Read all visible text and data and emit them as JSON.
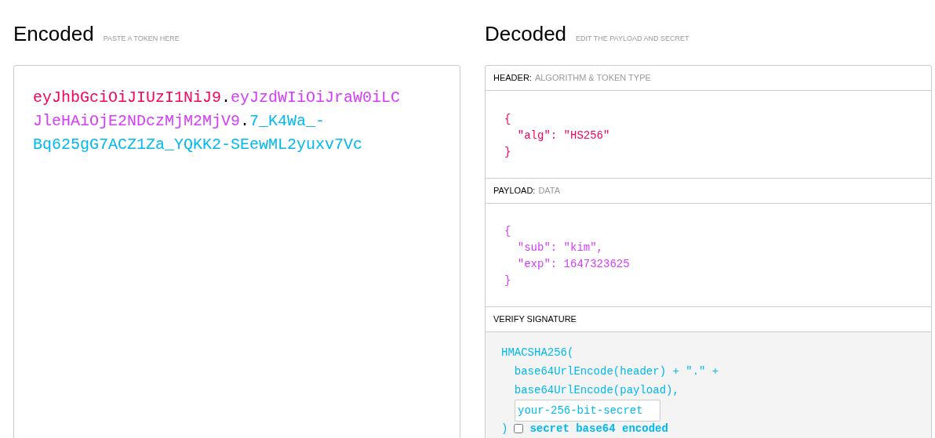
{
  "encoded": {
    "title": "Encoded",
    "hint": "PASTE A TOKEN HERE",
    "token_lines": [
      [
        {
          "kind": "header",
          "text": "eyJhbGciOiJIUzI1NiJ9"
        },
        {
          "kind": "dot",
          "text": "."
        },
        {
          "kind": "payload",
          "text": "eyJzdWIiOiJraW0iLC"
        }
      ],
      [
        {
          "kind": "payload",
          "text": "JleHAiOjE2NDczMjM2MjV9"
        },
        {
          "kind": "dot",
          "text": "."
        },
        {
          "kind": "signature",
          "text": "7_K4Wa_-"
        }
      ],
      [
        {
          "kind": "signature",
          "text": "Bq625gG7ACZ1Za_YQKK2-SEewML2yuxv7Vc"
        }
      ]
    ]
  },
  "decoded": {
    "title": "Decoded",
    "hint": "EDIT THE PAYLOAD AND SECRET",
    "sections": [
      {
        "kind": "header",
        "label": "HEADER:",
        "sublabel": "ALGORITHM & TOKEN TYPE",
        "lines": [
          "{",
          "  \"alg\": \"HS256\"",
          "}"
        ]
      },
      {
        "kind": "payload",
        "label": "PAYLOAD:",
        "sublabel": "DATA",
        "lines": [
          "{",
          "  \"sub\": \"kim\",",
          "  \"exp\": 1647323625",
          "}"
        ]
      },
      {
        "kind": "verify",
        "label": "VERIFY SIGNATURE",
        "lines": [
          "HMACSHA256(",
          "  base64UrlEncode(header) + \".\" +",
          "  base64UrlEncode(payload),"
        ],
        "secret": "your-256-bit-secret",
        "closing": ")",
        "base64_checked": false,
        "base64_label": "secret base64 encoded"
      }
    ]
  }
}
